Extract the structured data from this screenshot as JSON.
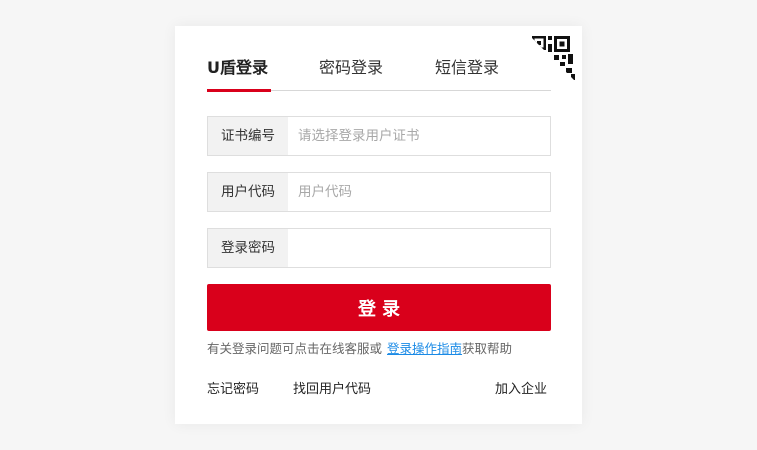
{
  "tabs": [
    {
      "label": "U盾登录",
      "active": true
    },
    {
      "label": "密码登录",
      "active": false
    },
    {
      "label": "短信登录",
      "active": false
    }
  ],
  "qr_corner": {
    "icon": "qr-code-icon"
  },
  "fields": {
    "certificate": {
      "label": "证书编号",
      "placeholder": "请选择登录用户证书",
      "value": ""
    },
    "user_code": {
      "label": "用户代码",
      "placeholder": "用户代码",
      "value": ""
    },
    "password": {
      "label": "登录密码",
      "placeholder": "",
      "value": ""
    }
  },
  "login_button": {
    "label": "登录"
  },
  "help": {
    "prefix": "有关登录问题可点击在线客服或",
    "link": "登录操作指南",
    "suffix": "获取帮助"
  },
  "links": {
    "forgot_password": "忘记密码",
    "retrieve_user_code": "找回用户代码",
    "join_enterprise": "加入企业"
  },
  "colors": {
    "accent": "#d9001b",
    "link": "#1a8ae6",
    "label_bg": "#f2f2f2",
    "page_bg": "#f6f6f6"
  }
}
